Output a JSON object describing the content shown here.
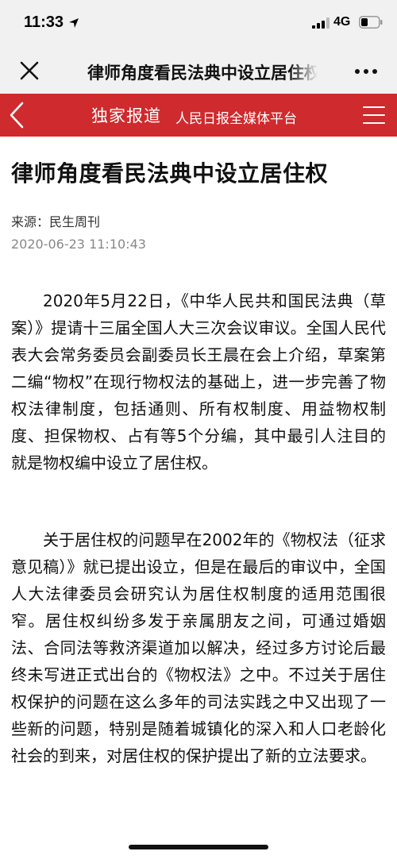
{
  "status": {
    "time": "11:33",
    "network": "4G",
    "icons": [
      "location-arrow-icon",
      "signal-icon",
      "battery-icon"
    ]
  },
  "titlebar": {
    "title": "律师角度看民法典中设立居住权",
    "icons": [
      "close-icon",
      "more-icon"
    ]
  },
  "header": {
    "brand": "独家报道",
    "subtitle": "人民日报全媒体平台",
    "color": "#cf2a2d",
    "icons": [
      "back-icon",
      "menu-icon"
    ]
  },
  "article": {
    "title": "律师角度看民法典中设立居住权",
    "source": "来源：民生周刊",
    "timestamp": "2020-06-23 11:10:43",
    "paragraphs": [
      "2020年5月22日，《中华人民共和国民法典（草案）》提请十三届全国人大三次会议审议。全国人民代表大会常务委员会副委员长王晨在会上介绍，草案第二编“物权”在现行物权法的基础上，进一步完善了物权法律制度，包括通则、所有权制度、用益物权制度、担保物权、占有等5个分编，其中最引人注目的就是物权编中设立了居住权。",
      "关于居住权的问题早在2002年的《物权法（征求意见稿）》就已提出设立，但是在最后的审议中，全国人大法律委员会研究认为居住权制度的适用范围很窄。居住权纠纷多发于亲属朋友之间，可通过婚姻法、合同法等救济渠道加以解决，经过多方讨论后最终未写进正式出台的《物权法》之中。不过关于居住权保护的问题在这么多年的司法实践之中又出现了一些新的问题，特别是随着城镇化的深入和人口老龄化社会的到来，对居住权的保护提出了新的立法要求。"
    ]
  }
}
